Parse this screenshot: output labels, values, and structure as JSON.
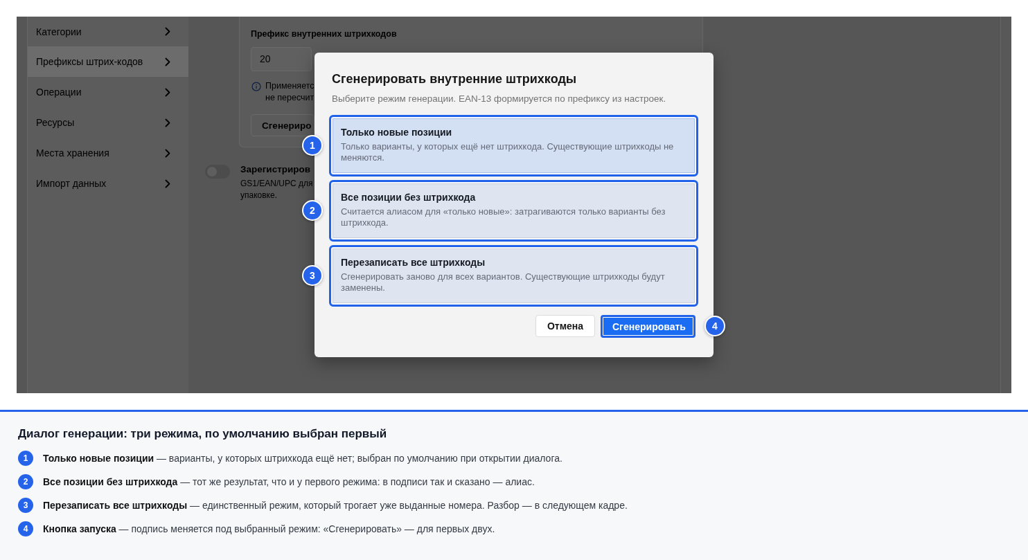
{
  "app": {
    "sidebar": {
      "items": [
        {
          "label": "Категории",
          "selected": false
        },
        {
          "label": "Префиксы штрих-кодов",
          "selected": true
        },
        {
          "label": "Операции",
          "selected": false
        },
        {
          "label": "Ресурсы",
          "selected": false
        },
        {
          "label": "Места хранения",
          "selected": false
        },
        {
          "label": "Импорт данных",
          "selected": false
        }
      ]
    },
    "prefix_card": {
      "label": "Префикс внутренних штрихкодов",
      "input": {
        "value": "20"
      },
      "hint_lines": [
        "Применяетс",
        "не пересчит"
      ],
      "button": "Сгенериро"
    },
    "register_setting": {
      "on": false,
      "title": "Зарегистриров",
      "description_lines": [
        "GS1/EAN/UPC для",
        "упаковке."
      ]
    }
  },
  "dialog": {
    "title": "Сгенерировать внутренние штрихкоды",
    "subtitle": "Выберите режим генерации. EAN-13 формируется по префиксу из настроек.",
    "options": [
      {
        "title": "Только новые позиции",
        "description": "Только варианты, у которых ещё нет штрихкода. Существующие штрихкоды не меняются.",
        "selected": true,
        "callout": "1"
      },
      {
        "title": "Все позиции без штрихкода",
        "description": "Считается алиасом для «только новые»: затрагиваются только варианты без штрихкода.",
        "selected": false,
        "callout": "2"
      },
      {
        "title": "Перезаписать все штрихкоды",
        "description": "Сгенерировать заново для всех вариантов. Существующие штрихкоды будут заменены.",
        "selected": false,
        "callout": "3"
      }
    ],
    "buttons": [
      {
        "label": "Отмена",
        "kind": "secondary"
      },
      {
        "label": "Сгенерировать",
        "kind": "primary",
        "callout": "4"
      }
    ]
  },
  "caption": {
    "heading": "Диалог генерации: три режима, по умолчанию выбран первый",
    "notes": [
      {
        "number": "1",
        "text": "**Только новые позиции** — варианты, у которых штрихкода ещё нет; выбран по умолчанию при открытии диалога."
      },
      {
        "number": "2",
        "text": "**Все позиции без штрихкода** — тот же результат, что и у первого режима: в подписи так и сказано — алиас."
      },
      {
        "number": "3",
        "text": "**Перезаписать все штрихкоды** — единственный режим, который трогает уже выданные номера. Разбор — в следующем кадре."
      },
      {
        "number": "4",
        "text": "**Кнопка запуска** — подпись меняется под выбранный режим: «Сгенерировать» — для первых двух."
      }
    ]
  }
}
